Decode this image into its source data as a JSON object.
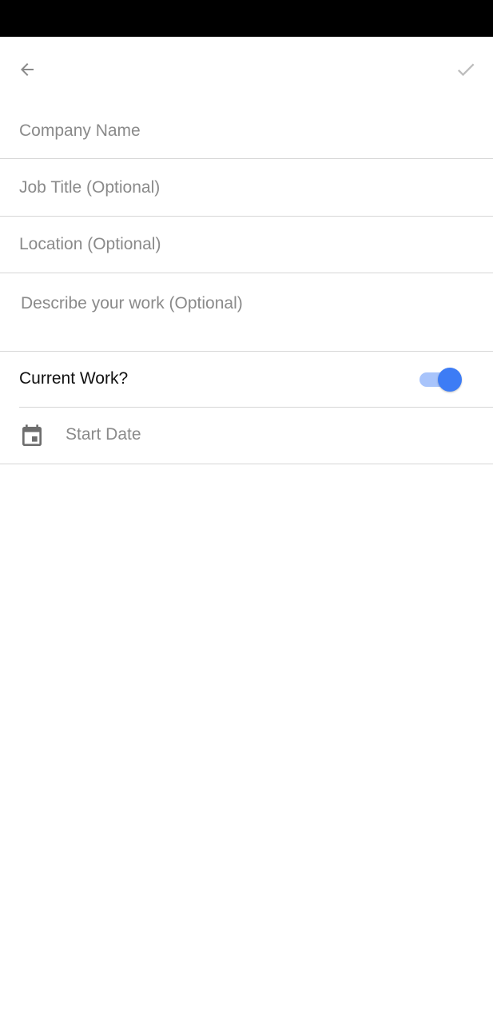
{
  "app": {
    "back_icon": "arrow-back-icon",
    "save_icon": "check-icon"
  },
  "form": {
    "company_name": {
      "value": "",
      "placeholder": "Company Name"
    },
    "job_title": {
      "value": "",
      "placeholder": "Job Title (Optional)"
    },
    "location": {
      "value": "",
      "placeholder": "Location (Optional)"
    },
    "description": {
      "value": "",
      "placeholder": "Describe your work (Optional)"
    },
    "current_work": {
      "label": "Current Work?",
      "enabled": true
    },
    "start_date": {
      "placeholder": "Start Date",
      "icon": "calendar-icon"
    }
  },
  "colors": {
    "accent": "#3d7cf5",
    "accent_track": "#a8c4fb",
    "placeholder": "#8a8a8a",
    "divider": "#d6d6d6",
    "icon_gray": "#8a8a8a"
  }
}
